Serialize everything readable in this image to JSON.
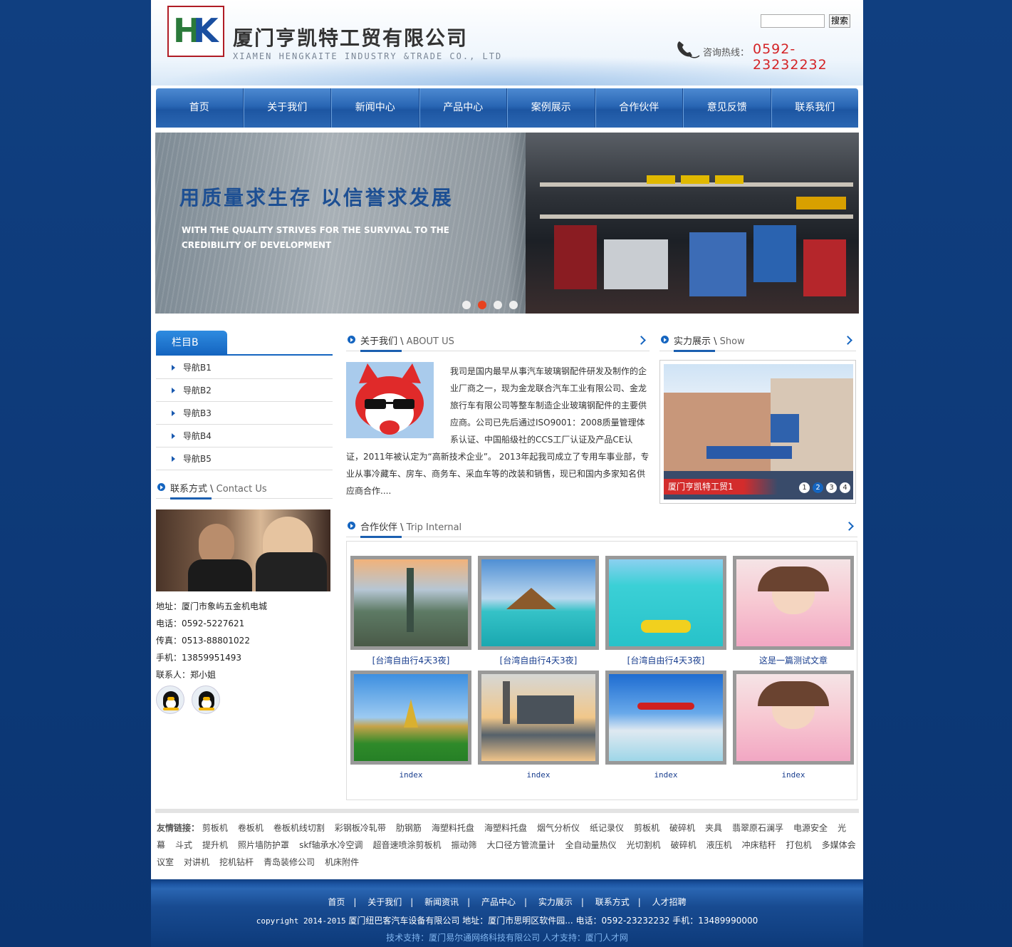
{
  "header": {
    "company_name": "厦门亨凯特工贸有限公司",
    "company_name_en": "XIAMEN HENGKAITE INDUSTRY &TRADE CO., LTD",
    "search_button": "搜索",
    "search_value": "",
    "hotline_label": "咨询热线：",
    "hotline_number": "0592-23232232"
  },
  "nav": {
    "items": [
      "首页",
      "关于我们",
      "新闻中心",
      "产品中心",
      "案例展示",
      "合作伙伴",
      "意见反馈",
      "联系我们"
    ]
  },
  "banner": {
    "title": "用质量求生存 以信誉求发展",
    "subtitle_line1": "WITH THE QUALITY STRIVES FOR THE SURVIVAL TO THE",
    "subtitle_line2": "CREDIBILITY OF DEVELOPMENT",
    "slide_count": 4,
    "active_slide": 2
  },
  "sidebar": {
    "tab_title": "栏目B",
    "items": [
      "导航B1",
      "导航B2",
      "导航B3",
      "导航B4",
      "导航B5"
    ],
    "contact": {
      "title": "联系方式",
      "title_en": "Contact Us",
      "address": "地址：厦门市象屿五金机电城",
      "phone": "电话：0592-5227621",
      "fax": "传真：0513-88801022",
      "mobile": "手机：13859951493",
      "person": "联系人：郑小姐"
    }
  },
  "about": {
    "title": "关于我们",
    "title_en": "ABOUT US",
    "text": "我司是国内最早从事汽车玻璃钢配件研发及制作的企业厂商之一，现为金龙联合汽车工业有限公司、金龙旅行车有限公司等整车制造企业玻璃钢配件的主要供应商。公司已先后通过ISO9001：2008质量管理体系认证、中国船级社的CCS工厂认证及产品CE认证，2011年被认定为“高新技术企业”。 2013年起我司成立了专用车事业部，专业从事冷藏车、房车、商务车、采血车等的改装和销售，现已和国内多家知名供应商合作...."
  },
  "show": {
    "title": "实力展示",
    "title_en": "Show",
    "caption": "厦门亨凯特工贸1",
    "pages": [
      "1",
      "2",
      "3",
      "4"
    ],
    "active_page": 2
  },
  "partners": {
    "title": "合作伙伴",
    "title_en": "Trip Internal",
    "captions_row1": [
      "[台湾自由行4天3夜]",
      "[台湾自由行4天3夜]",
      "[台湾自由行4天3夜]",
      "这是一篇测试文章"
    ],
    "captions_row2": [
      "index",
      "index",
      "index",
      "index"
    ]
  },
  "links": {
    "label": "友情链接：",
    "items": [
      "剪板机",
      "卷板机",
      "卷板机线切割",
      "彩钢板冷轧带",
      "肋钢筋",
      "海塑料托盘",
      "海塑料托盘",
      "烟气分析仪",
      "纸记录仪",
      "剪板机",
      "破碎机",
      "夹具",
      "翡翠原石澜孚",
      "电源安全",
      "光幕",
      "斗式",
      "提升机",
      "照片墙防护罩",
      "skf轴承水冷空调",
      "超音速喷涂剪板机",
      "振动筛",
      "大口径方管流量计",
      "全自动量热仪",
      "光切割机",
      "破碎机",
      "液压机",
      "冲床秸秆",
      "打包机",
      "多媒体会议室",
      "对讲机",
      "挖机钻杆",
      "青岛装修公司",
      "机床附件"
    ]
  },
  "footer": {
    "nav": [
      "首页",
      "关于我们",
      "新闻资讯",
      "产品中心",
      "实力展示",
      "联系方式",
      "人才招聘"
    ],
    "copyright": "copyright 2014-2015",
    "company_line": "厦门纽巴客汽车设备有限公司 地址：厦门市思明区软件园... 电话：0592-23232232 手机：13489990000",
    "tech_support": "技术支持：厦门易尔通网络科技有限公司  人才支持：厦门人才网"
  },
  "colors": {
    "page_bg": "#0d3a7a",
    "nav_blue": "#2966b4",
    "accent_red": "#d42326",
    "link_blue": "#1a3f8f"
  }
}
